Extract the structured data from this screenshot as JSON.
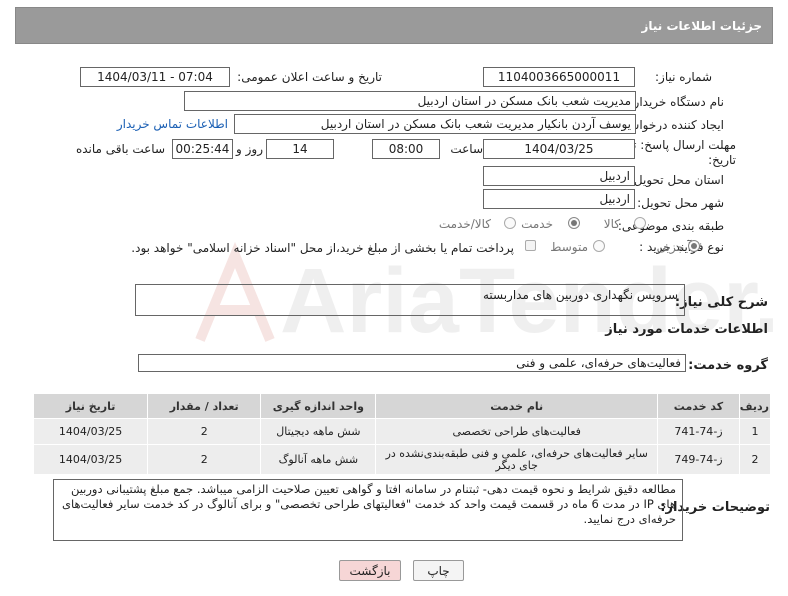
{
  "header": {
    "title": "جزئیات اطلاعات نیاز"
  },
  "form": {
    "need_number_label": "شماره نیاز:",
    "need_number": "1104003665000011",
    "announce_label": "تاریخ و ساعت اعلان عمومی:",
    "announce_value": "1404/03/11 - 07:04",
    "buyer_org_label": "نام دستگاه خریدار:",
    "buyer_org": "مدیریت شعب بانک مسکن در استان اردبیل",
    "creator_label": "ایجاد کننده درخواست:",
    "creator": "یوسف  آردن بانکیار مدیریت شعب بانک مسکن در استان اردبیل",
    "contact_link": "اطلاعات تماس خریدار",
    "deadline_label_1": "مهلت ارسال پاسخ: تا",
    "deadline_label_2": "تاریخ:",
    "deadline_date": "1404/03/25",
    "time_label": "ساعت",
    "deadline_time": "08:00",
    "days_value": "14",
    "days_label": "روز و",
    "remaining_time": "00:25:44",
    "remaining_label": "ساعت باقی مانده",
    "province_label": "استان محل تحویل:",
    "province": "اردبیل",
    "city_label": "شهر محل تحویل:",
    "city": "اردبیل",
    "category_label": "طبقه بندی موضوعی:",
    "category_options": [
      "کالا",
      "خدمت",
      "کالا/خدمت"
    ],
    "category_selected": "خدمت",
    "process_label": "نوع فرآیند خرید :",
    "process_options": [
      "جزیی",
      "متوسط"
    ],
    "process_selected": "جزیی",
    "payment_note": "پرداخت تمام یا بخشی از مبلغ خرید،از محل \"اسناد خزانه اسلامی\" خواهد بود."
  },
  "summary": {
    "label": "شرح کلی نیاز:",
    "value": "سرویس نگهداری دوربین های مداربسته"
  },
  "services": {
    "section_title": "اطلاعات خدمات مورد نیاز",
    "group_label": "گروه خدمت:",
    "group_value": "فعالیت‌های حرفه‌ای، علمی و فنی",
    "columns": [
      "ردیف",
      "کد خدمت",
      "نام خدمت",
      "واحد اندازه گیری",
      "تعداد / مقدار",
      "تاریخ نیاز"
    ],
    "rows": [
      [
        "1",
        "ز-74-741",
        "فعالیت‌های طراحی تخصصی",
        "شش ماهه دیجیتال",
        "2",
        "1404/03/25"
      ],
      [
        "2",
        "ز-74-749",
        "سایر فعالیت‌های حرفه‌ای، علمی و فنی طبقه‌بندی‌نشده در جای دیگر",
        "شش ماهه آنالوگ",
        "2",
        "1404/03/25"
      ]
    ]
  },
  "notes": {
    "label": "توضیحات خریدار:",
    "text": "مطالعه دقیق شرایط و نحوه قیمت دهی- ثبتنام در سامانه افتا و گواهی تعیین صلاحیت الزامی میباشد. جمع مبلغ پشتیبانی دوربین های IP در مدت 6 ماه در قسمت قیمت واحد کد خدمت \"فعالیتهای طراحی تخصصی\" و برای آنالوگ در کد خدمت سایر فعالیت‌های حرفه‌ای درج نمایید."
  },
  "buttons": {
    "print": "چاپ",
    "back": "بازگشت"
  },
  "watermark": {
    "text": "AriaTender.neT"
  },
  "colors": {
    "header_bg": "#9a9a9a",
    "link": "#1a5fb4",
    "back_button_bg": "#f6d6d6",
    "watermark": "#c0392b"
  }
}
